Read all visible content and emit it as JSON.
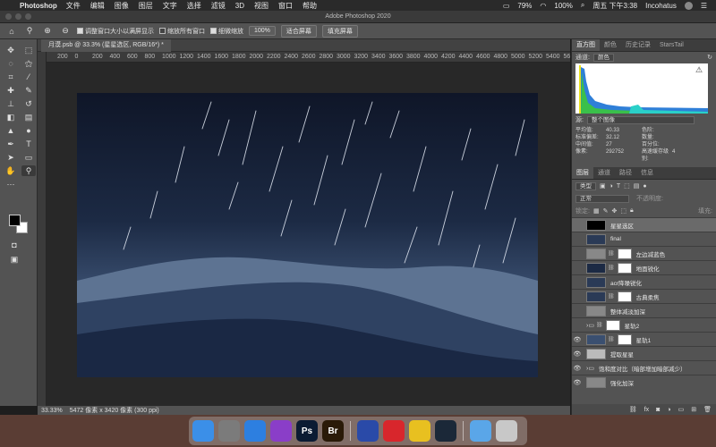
{
  "menubar": {
    "app": "Photoshop",
    "items": [
      "文件",
      "编辑",
      "图像",
      "图层",
      "文字",
      "选择",
      "滤镜",
      "3D",
      "视图",
      "窗口",
      "帮助"
    ],
    "battery": "79%",
    "battery2": "100%",
    "datetime": "周五 下午3:38",
    "user": "Incohatus"
  },
  "window": {
    "title": "Adobe Photoshop 2020"
  },
  "options": {
    "check1": "调整窗口大小以满屏显示",
    "check2": "缩放所有窗口",
    "check3": "细微缩放",
    "zoom": "100%",
    "fit": "适合屏幕",
    "fill": "填充屏幕"
  },
  "document": {
    "tab": "月漠.psb @ 33.3% (星星选区, RGB/16*) *"
  },
  "ruler": {
    "ticks": [
      "200",
      "0",
      "200",
      "400",
      "600",
      "800",
      "1000",
      "1200",
      "1400",
      "1600",
      "1800",
      "2000",
      "2200",
      "2400",
      "2600",
      "2800",
      "3000",
      "3200",
      "3400",
      "3600",
      "3800",
      "4000",
      "4200",
      "4400",
      "4600",
      "4800",
      "5000",
      "5200",
      "5400",
      "5600",
      "58"
    ]
  },
  "status": {
    "zoom": "33.33%",
    "info": "5472 像素 x 3420 像素 (300 ppi)"
  },
  "histogram": {
    "tabs": [
      "直方图",
      "颜色",
      "历史记录",
      "StarsTail"
    ],
    "channel_label": "通道:",
    "channel": "颜色",
    "source_label": "源:",
    "source": "整个图像",
    "stats": [
      [
        "平均值:",
        "40.33",
        "色阶:",
        ""
      ],
      [
        "标准偏差:",
        "32.12",
        "数量:",
        ""
      ],
      [
        "中间值:",
        "27",
        "百分位:",
        ""
      ],
      [
        "像素:",
        "292752",
        "高速缓存级别:",
        "4"
      ]
    ]
  },
  "layers": {
    "tabs": [
      "图层",
      "通道",
      "路径",
      "信息"
    ],
    "filter": "类型",
    "blend": "正常",
    "opacity_label": "不透明度:",
    "lock_label": "锁定:",
    "fill_label": "填充:",
    "items": [
      {
        "name": "星星选区",
        "thumb": "#000000",
        "mask": false,
        "visible": false,
        "group": false
      },
      {
        "name": "final",
        "thumb": "#2a3a56",
        "mask": false,
        "visible": false,
        "group": false
      },
      {
        "name": "左边减蓝色",
        "thumb": "#888888",
        "mask": true,
        "visible": false,
        "group": false
      },
      {
        "name": "地面锐化",
        "thumb": "#1c2a44",
        "mask": true,
        "visible": false,
        "group": false
      },
      {
        "name": "acr降噪锐化",
        "thumb": "#2a3a56",
        "mask": false,
        "visible": false,
        "group": false
      },
      {
        "name": "古典柔焦",
        "thumb": "#2a3a56",
        "mask": true,
        "visible": false,
        "group": false
      },
      {
        "name": "整体减淡加深",
        "thumb": "#888888",
        "mask": false,
        "visible": false,
        "group": false
      },
      {
        "name": "星轨2",
        "thumb": "#777777",
        "mask": true,
        "visible": false,
        "group": true
      },
      {
        "name": "星轨1",
        "thumb": "#3a4f70",
        "mask": true,
        "visible": true,
        "group": false
      },
      {
        "name": "提取星星",
        "thumb": "#bbbbbb",
        "mask": false,
        "visible": true,
        "group": false
      },
      {
        "name": "饱和度对比（暗部增加暗部减少）",
        "thumb": "#777777",
        "mask": false,
        "visible": true,
        "group": true
      },
      {
        "name": "强化加深",
        "thumb": "#888888",
        "mask": false,
        "visible": true,
        "group": false
      }
    ]
  },
  "dock": {
    "apps": [
      {
        "name": "finder",
        "label": "",
        "color": "#3b8fe8"
      },
      {
        "name": "launchpad",
        "label": "",
        "color": "#7b7b7b"
      },
      {
        "name": "safari",
        "label": "",
        "color": "#2d7fe0"
      },
      {
        "name": "affinity",
        "label": "",
        "color": "#8a3ec8"
      },
      {
        "name": "photoshop",
        "label": "Ps",
        "color": "#0b1b33"
      },
      {
        "name": "bridge",
        "label": "Br",
        "color": "#2a1a08"
      },
      {
        "name": "affinity-photo",
        "label": "",
        "color": "#2a4aa8"
      },
      {
        "name": "netease-music",
        "label": "",
        "color": "#d8262c"
      },
      {
        "name": "qq-browser",
        "label": "",
        "color": "#e8c020"
      },
      {
        "name": "steam",
        "label": "",
        "color": "#1b2838"
      },
      {
        "name": "folder",
        "label": "",
        "color": "#5aa6e8"
      },
      {
        "name": "trash",
        "label": "",
        "color": "#c8c8c8"
      }
    ]
  }
}
